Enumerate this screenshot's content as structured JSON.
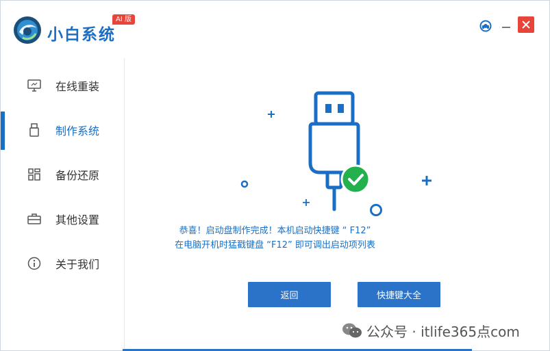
{
  "app": {
    "title": "小白系统",
    "badge": "AI 版"
  },
  "header": {
    "support_icon": "headset-icon",
    "minimize_icon": "minimize-icon",
    "close_icon": "close-icon"
  },
  "sidebar": {
    "items": [
      {
        "label": "在线重装",
        "icon": "monitor-icon",
        "active": false
      },
      {
        "label": "制作系统",
        "icon": "usb-drive-icon",
        "active": true
      },
      {
        "label": "备份还原",
        "icon": "grid-icon",
        "active": false
      },
      {
        "label": "其他设置",
        "icon": "briefcase-icon",
        "active": false
      },
      {
        "label": "关于我们",
        "icon": "info-icon",
        "active": false
      }
    ]
  },
  "main": {
    "illustration": "usb-success-illustration",
    "message_line1": "恭喜！启动盘制作完成！本机启动快捷键 “ F12”",
    "message_line2": "在电脑开机时猛戳键盘 “F12” 即可调出启动项列表",
    "back_button": "返回",
    "hotkeys_button": "快捷键大全"
  },
  "watermark": {
    "text": "公众号 · itlife365点com"
  },
  "colors": {
    "accent": "#1a6fc4",
    "button": "#2a73c9",
    "close": "#e8443a",
    "success": "#22b14c"
  }
}
